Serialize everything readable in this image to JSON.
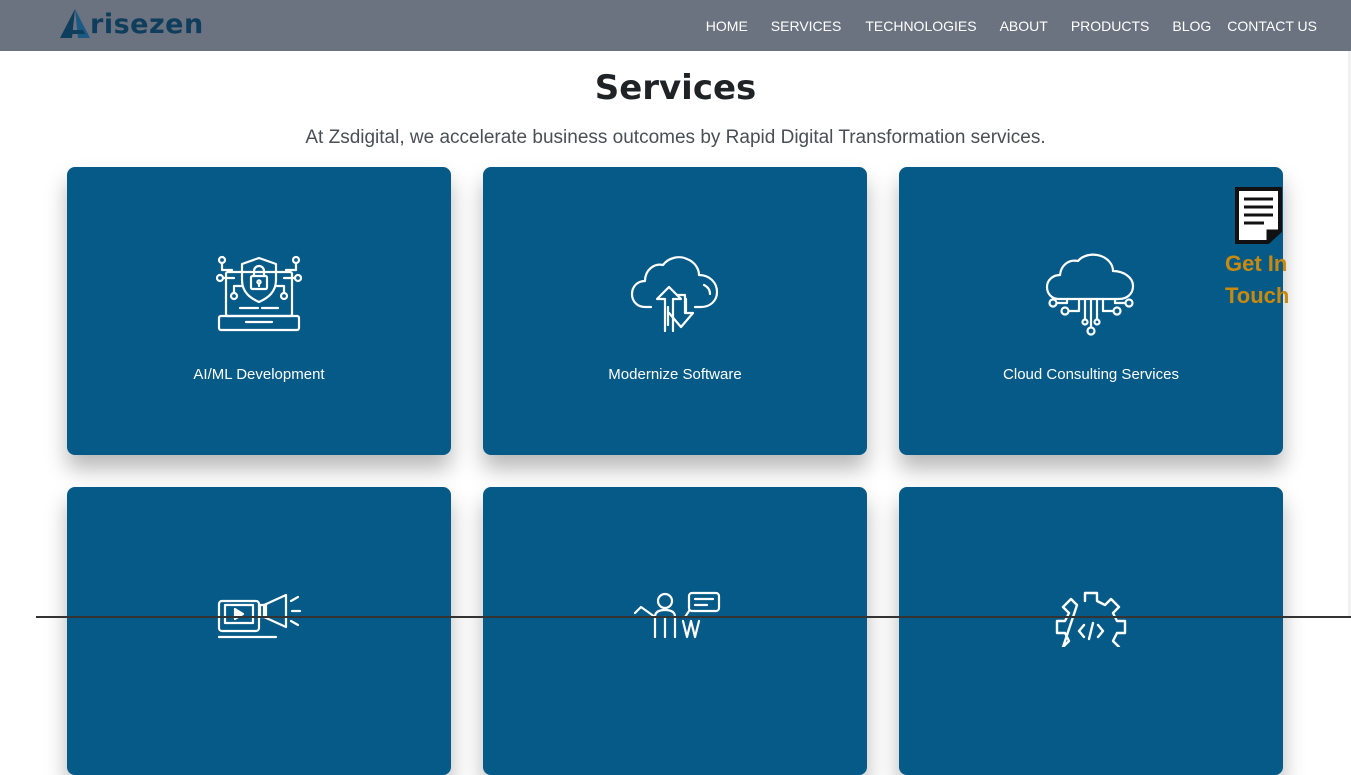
{
  "brand": {
    "name": "risezen",
    "logo_letter_icon": "triangle-a-logo",
    "brand_color": "#0f3d5c"
  },
  "nav": {
    "items": [
      {
        "label": "HOME"
      },
      {
        "label": "SERVICES"
      },
      {
        "label": "TECHNOLOGIES"
      },
      {
        "label": "ABOUT"
      },
      {
        "label": "PRODUCTS"
      },
      {
        "label": "BLOG"
      },
      {
        "label": "CONTACT US"
      }
    ],
    "bg_color": "#6b7280"
  },
  "section": {
    "title": "Services",
    "subtitle": "At Zsdigital, we accelerate business outcomes by Rapid Digital Transformation services."
  },
  "cards": [
    {
      "label": "AI/ML Development",
      "icon": "secure-laptop-icon"
    },
    {
      "label": "Modernize Software",
      "icon": "cloud-transfer-icon"
    },
    {
      "label": "Cloud Consulting Services",
      "icon": "cloud-network-icon"
    },
    {
      "label": "",
      "icon": "media-marketing-icon"
    },
    {
      "label": "",
      "icon": "presentation-icon"
    },
    {
      "label": "",
      "icon": "gear-code-icon"
    }
  ],
  "card_color": "#065a87",
  "floating_cta": {
    "label": "Get In Touch",
    "icon": "document-icon",
    "color": "#c98a0b"
  }
}
